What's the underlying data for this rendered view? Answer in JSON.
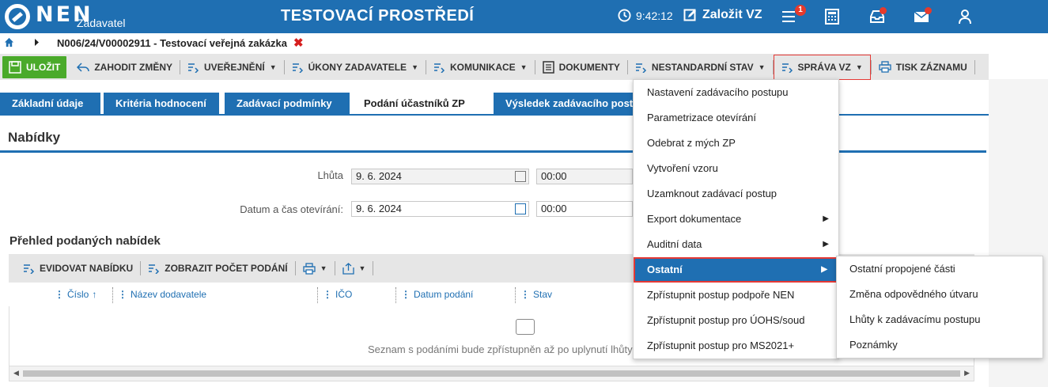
{
  "header": {
    "logo_text": "NEN",
    "logo_sub": "Zadavatel",
    "env_title": "TESTOVACÍ PROSTŘEDÍ",
    "time": "9:42:12",
    "new_btn": "Založit VZ",
    "notif_count": "1",
    "icons": [
      "clock-icon",
      "edit-icon",
      "menu-icon",
      "calculator-icon",
      "inbox-icon",
      "mail-icon",
      "user-icon"
    ],
    "accent": "#1f6fb2",
    "alert": "#e63a2c"
  },
  "breadcrumb": {
    "title": "N006/24/V00002911 - Testovací veřejná zakázka"
  },
  "toolbar": {
    "save": "ULOŽIT",
    "discard": "ZAHODIT ZMĚNY",
    "publish": "UVEŘEJNĚNÍ",
    "acts": "ÚKONY ZADAVATELE",
    "comm": "KOMUNIKACE",
    "docs": "DOKUMENTY",
    "nonstd": "NESTANDARDNÍ STAV",
    "mgmt": "SPRÁVA VZ",
    "print": "TISK ZÁZNAMU",
    "save_color": "#4aaa2a"
  },
  "tabs": [
    {
      "label": "Základní údaje"
    },
    {
      "label": "Kritéria hodnocení"
    },
    {
      "label": "Zadávací podmínky"
    },
    {
      "label": "Podání účastníků ZP"
    },
    {
      "label": "Výsledek zadávacího post"
    }
  ],
  "section": {
    "title": "Nabídky",
    "deadline_label": "Lhůta",
    "deadline_date": "9. 6. 2024",
    "deadline_time": "00:00",
    "opening_label": "Datum a čas otevírání:",
    "opening_date": "9. 6. 2024",
    "opening_time": "00:00"
  },
  "grid": {
    "title": "Přehled podaných nabídek",
    "btn_register": "EVIDOVAT NABÍDKU",
    "btn_count": "ZOBRAZIT POČET PODÁNÍ",
    "columns": {
      "number": "Číslo",
      "supplier": "Název dodavatele",
      "ico": "IČO",
      "date": "Datum podání",
      "status": "Stav"
    },
    "empty_text": "Seznam s podáními bude zpřístupněn až po uplynutí lhůty p"
  },
  "menu": {
    "items": [
      "Nastavení zadávacího postupu",
      "Parametrizace otevírání",
      "Odebrat z mých ZP",
      "Vytvoření vzoru",
      "Uzamknout zadávací postup",
      "Export dokumentace",
      "Auditní data",
      "Ostatní",
      "Zpřístupnit postup podpoře NEN",
      "Zpřístupnit postup pro ÚOHS/soud",
      "Zpřístupnit postup pro MS2021+"
    ]
  },
  "submenu": {
    "items": [
      "Ostatní propojené části",
      "Změna odpovědného útvaru",
      "Lhůty k zadávacímu postupu",
      "Poznámky"
    ]
  }
}
